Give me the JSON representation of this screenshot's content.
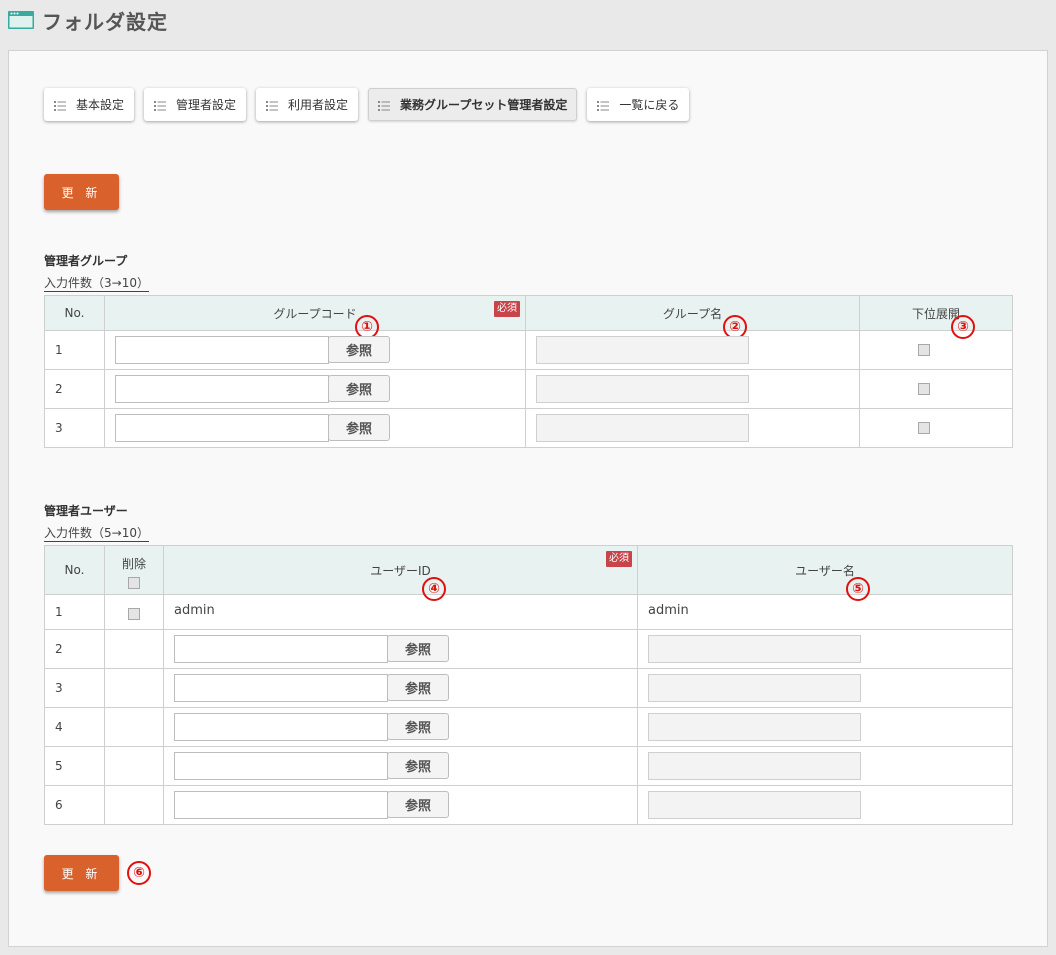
{
  "header": {
    "title": "フォルダ設定",
    "icon": "window-icon",
    "icon_color": "#3aa99f"
  },
  "tabs": [
    {
      "label": "基本設定",
      "icon": "list-icon",
      "active": false
    },
    {
      "label": "管理者設定",
      "icon": "list-icon",
      "active": false
    },
    {
      "label": "利用者設定",
      "icon": "list-icon",
      "active": false
    },
    {
      "label": "業務グループセット管理者設定",
      "icon": "list-icon",
      "active": true
    },
    {
      "label": "一覧に戻る",
      "icon": "list-icon",
      "active": false
    }
  ],
  "update_label": "更 新",
  "accent_color": "#d9612c",
  "group_section": {
    "title": "管理者グループ",
    "count_link": "入力件数（3→10）",
    "headers": {
      "no": "No.",
      "code": "グループコード",
      "name": "グループ名",
      "expand": "下位展開"
    },
    "required": "必須",
    "ref_label": "参照",
    "rows": [
      {
        "no": "1",
        "code": "",
        "name": ""
      },
      {
        "no": "2",
        "code": "",
        "name": ""
      },
      {
        "no": "3",
        "code": "",
        "name": ""
      }
    ]
  },
  "user_section": {
    "title": "管理者ユーザー",
    "count_link": "入力件数（5→10）",
    "headers": {
      "no": "No.",
      "delete": "削除",
      "user_id": "ユーザーID",
      "user_name": "ユーザー名"
    },
    "required": "必須",
    "ref_label": "参照",
    "fixed_row": {
      "no": "1",
      "user_id": "admin",
      "user_name": "admin"
    },
    "rows": [
      {
        "no": "2",
        "user_id": "",
        "user_name": ""
      },
      {
        "no": "3",
        "user_id": "",
        "user_name": ""
      },
      {
        "no": "4",
        "user_id": "",
        "user_name": ""
      },
      {
        "no": "5",
        "user_id": "",
        "user_name": ""
      },
      {
        "no": "6",
        "user_id": "",
        "user_name": ""
      }
    ]
  },
  "markers": [
    "①",
    "②",
    "③",
    "④",
    "⑤",
    "⑥"
  ],
  "marker_color": "#e01010"
}
